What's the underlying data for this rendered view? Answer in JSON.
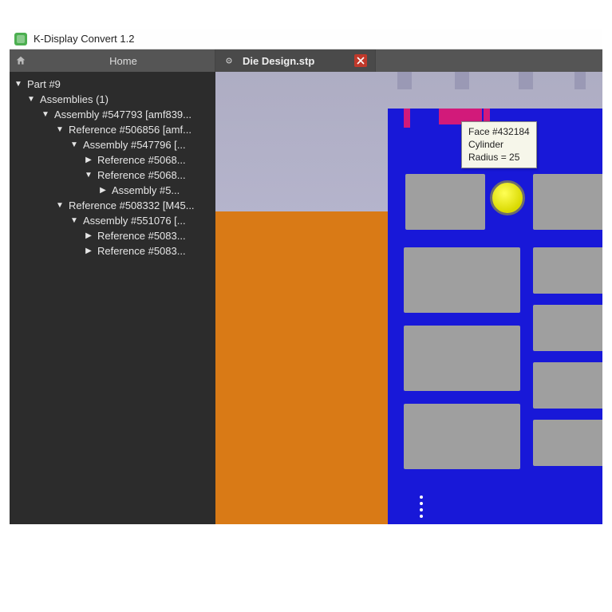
{
  "app": {
    "title": "K-Display Convert 1.2"
  },
  "toolbar": {
    "home_label": "Home"
  },
  "tabs": {
    "active": {
      "label": "Die Design.stp"
    }
  },
  "tree": [
    {
      "indent": 0,
      "arrow": "down",
      "label": "Part #9"
    },
    {
      "indent": 1,
      "arrow": "down",
      "label": "Assemblies (1)"
    },
    {
      "indent": 2,
      "arrow": "down",
      "label": "Assembly #547793 [amf839..."
    },
    {
      "indent": 3,
      "arrow": "down",
      "label": "Reference #506856 [amf..."
    },
    {
      "indent": 4,
      "arrow": "down",
      "label": "Assembly #547796 [..."
    },
    {
      "indent": 5,
      "arrow": "right",
      "label": "Reference #5068..."
    },
    {
      "indent": 5,
      "arrow": "down",
      "label": "Reference #5068..."
    },
    {
      "indent": 6,
      "arrow": "right",
      "label": "Assembly #5..."
    },
    {
      "indent": 3,
      "arrow": "down",
      "label": "Reference #508332 [M45..."
    },
    {
      "indent": 4,
      "arrow": "down",
      "label": "Assembly #551076 [..."
    },
    {
      "indent": 5,
      "arrow": "right",
      "label": "Reference #5083..."
    },
    {
      "indent": 5,
      "arrow": "right",
      "label": "Reference #5083..."
    }
  ],
  "tooltip": {
    "line1": "Face #432184",
    "line2": "Cylinder",
    "line3": "Radius = 25"
  },
  "colors": {
    "blue": "#1818d8",
    "orange": "#d97a16",
    "magenta": "#d21a7a",
    "yellow": "#e8e800",
    "panel": "#2c2c2c"
  }
}
